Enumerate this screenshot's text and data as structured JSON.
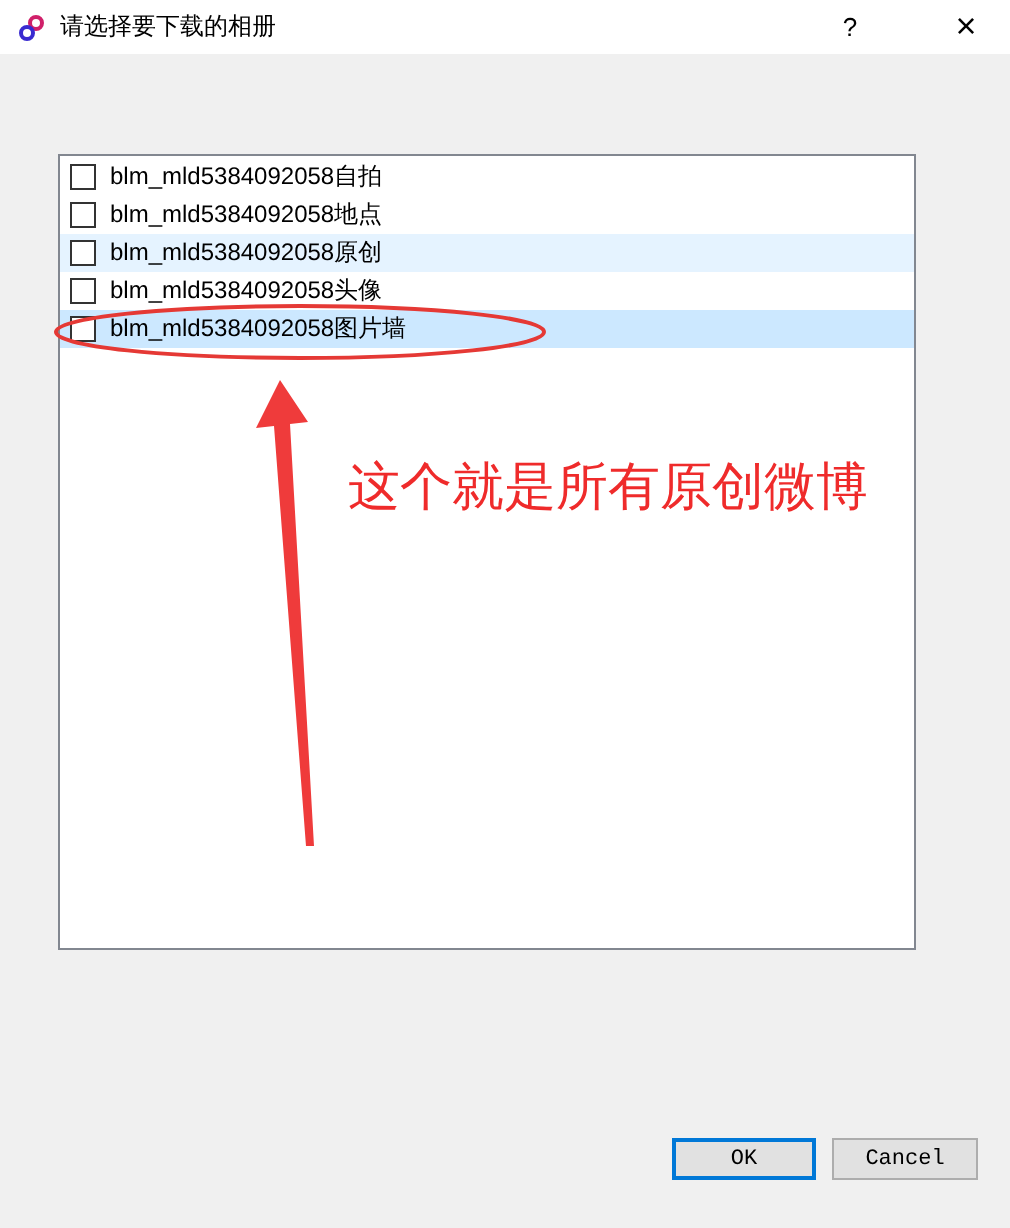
{
  "window": {
    "title": "请选择要下载的相册",
    "help": "?",
    "close": "×"
  },
  "albums": [
    {
      "label": "blm_mld5384092058自拍",
      "checked": false,
      "selected": false,
      "hovered": false
    },
    {
      "label": "blm_mld5384092058地点",
      "checked": false,
      "selected": false,
      "hovered": false
    },
    {
      "label": "blm_mld5384092058原创",
      "checked": false,
      "selected": false,
      "hovered": true
    },
    {
      "label": "blm_mld5384092058头像",
      "checked": false,
      "selected": false,
      "hovered": false
    },
    {
      "label": "blm_mld5384092058图片墙",
      "checked": false,
      "selected": true,
      "hovered": false
    }
  ],
  "annotation": {
    "text": "这个就是所有原创微博"
  },
  "buttons": [
    {
      "label": "OK",
      "default": true
    },
    {
      "label": "Cancel",
      "default": false
    }
  ]
}
